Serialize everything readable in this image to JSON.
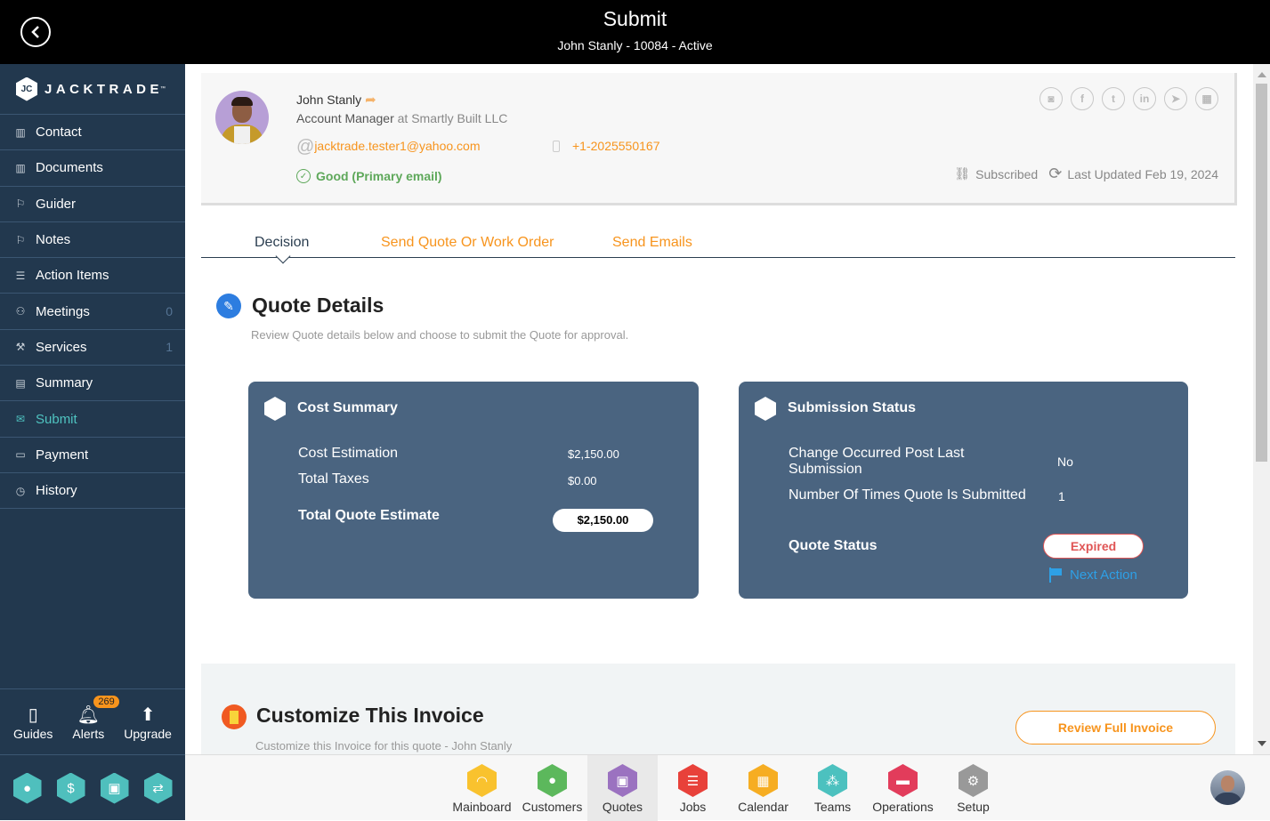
{
  "header": {
    "title": "Submit",
    "subtitle": "John Stanly - 10084 - Active"
  },
  "brand": {
    "name": "JACKTRADE",
    "tm": "™"
  },
  "sidebar": {
    "items": [
      {
        "label": "Contact",
        "icon": "contact-book-icon",
        "count": ""
      },
      {
        "label": "Documents",
        "icon": "documents-icon",
        "count": ""
      },
      {
        "label": "Guider",
        "icon": "signpost-icon",
        "count": ""
      },
      {
        "label": "Notes",
        "icon": "signpost-icon",
        "count": ""
      },
      {
        "label": "Action Items",
        "icon": "clipboard-icon",
        "count": ""
      },
      {
        "label": "Meetings",
        "icon": "meetings-icon",
        "count": "0"
      },
      {
        "label": "Services",
        "icon": "services-icon",
        "count": "1"
      },
      {
        "label": "Summary",
        "icon": "summary-icon",
        "count": ""
      },
      {
        "label": "Submit",
        "icon": "submit-icon",
        "count": "",
        "active": true
      },
      {
        "label": "Payment",
        "icon": "payment-icon",
        "count": ""
      },
      {
        "label": "History",
        "icon": "history-icon",
        "count": ""
      }
    ],
    "utilities": [
      {
        "label": "Guides"
      },
      {
        "label": "Alerts",
        "badge": "269"
      },
      {
        "label": "Upgrade"
      }
    ]
  },
  "profile": {
    "name": "John Stanly",
    "role": "Account Manager",
    "at": "at",
    "company": "Smartly Built LLC",
    "email": "jacktrade.tester1@yahoo.com",
    "phone": "+1-2025550167",
    "email_status": "Good (Primary email)",
    "subscription": "Subscribed",
    "last_updated": "Last Updated Feb 19, 2024"
  },
  "tabs": [
    {
      "label": "Decision",
      "active": true
    },
    {
      "label": "Send Quote Or Work Order"
    },
    {
      "label": "Send Emails"
    }
  ],
  "quote_details": {
    "title": "Quote Details",
    "subtitle": "Review Quote details below and choose to submit the Quote for approval."
  },
  "cost_summary": {
    "title": "Cost Summary",
    "cost_estimation_label": "Cost Estimation",
    "cost_estimation": "$2,150.00",
    "total_taxes_label": "Total Taxes",
    "total_taxes": "$0.00",
    "total_label": "Total Quote Estimate",
    "total": "$2,150.00"
  },
  "submission_status": {
    "title": "Submission Status",
    "change_label": "Change Occurred Post Last Submission",
    "change_value": "No",
    "times_label": "Number Of Times Quote Is Submitted",
    "times_value": "1",
    "status_label": "Quote Status",
    "status_value": "Expired",
    "next_action": "Next Action"
  },
  "invoice": {
    "title": "Customize This Invoice",
    "subtitle": "Customize this Invoice for this quote - John Stanly",
    "review_button": "Review Full Invoice"
  },
  "bottom_apps": [
    {
      "label": "Mainboard",
      "color": "#f9c22e"
    },
    {
      "label": "Customers",
      "color": "#5cb85c"
    },
    {
      "label": "Quotes",
      "color": "#9b72c0",
      "active": true
    },
    {
      "label": "Jobs",
      "color": "#e8413a"
    },
    {
      "label": "Calendar",
      "color": "#f6ad22"
    },
    {
      "label": "Teams",
      "color": "#4cc1bf"
    },
    {
      "label": "Operations",
      "color": "#e23c5b"
    },
    {
      "label": "Setup",
      "color": "#999999"
    }
  ],
  "colors": {
    "accent": "#f7941d",
    "sidebar": "#22384e",
    "card": "#4a6480",
    "active_nav": "#4fc3c0",
    "expired": "#e05555",
    "link": "#2ea0e6"
  }
}
